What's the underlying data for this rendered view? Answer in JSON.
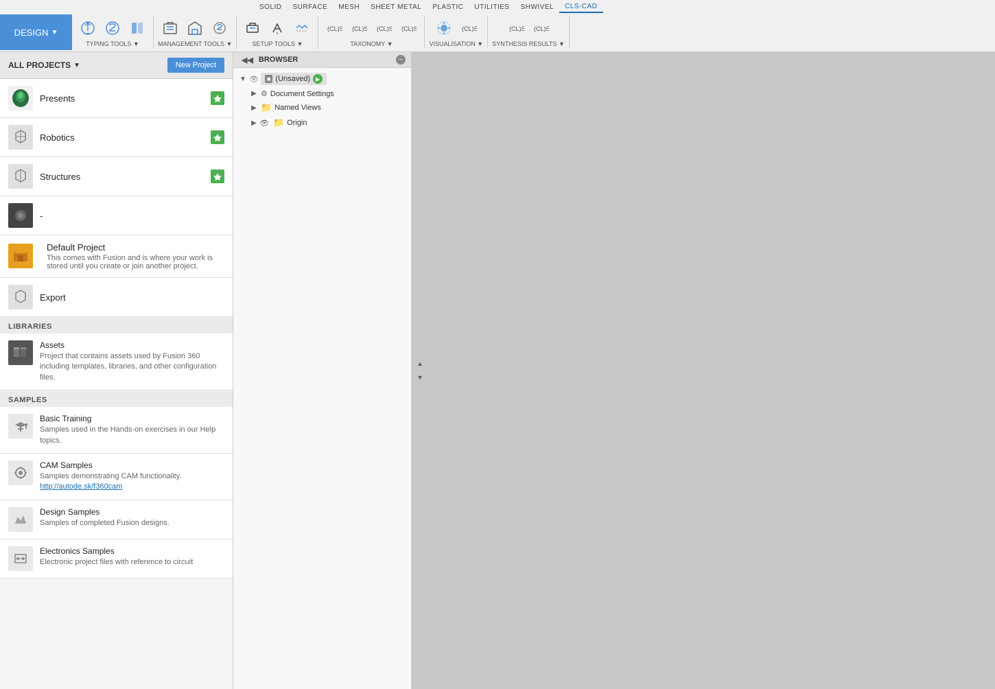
{
  "toolbar": {
    "design_label": "DESIGN",
    "design_chevron": "▼",
    "sections": [
      {
        "id": "solid",
        "label": "SOLID"
      },
      {
        "id": "surface",
        "label": "SURFACE"
      },
      {
        "id": "mesh",
        "label": "MESH"
      },
      {
        "id": "sheet_metal",
        "label": "SHEET METAL"
      },
      {
        "id": "plastic",
        "label": "PLASTIC"
      },
      {
        "id": "utilities",
        "label": "UTILITIES"
      },
      {
        "id": "shwivel",
        "label": "SHWIVEL"
      },
      {
        "id": "cls_cad",
        "label": "CLS-CAD",
        "active": true
      }
    ],
    "groups": [
      {
        "id": "typing_tools",
        "label": "TYPING TOOLS ▼"
      },
      {
        "id": "management_tools",
        "label": "MANAGEMENT TOOLS ▼"
      },
      {
        "id": "setup_tools",
        "label": "SETUP TOOLS ▼"
      },
      {
        "id": "taxonomy",
        "label": "TAXONOMY ▼"
      },
      {
        "id": "visualisation",
        "label": "VISUALISATION ▼"
      },
      {
        "id": "synthesis_results",
        "label": "SYNTHESIS RESULTS ▼"
      }
    ]
  },
  "sidebar": {
    "all_projects_label": "ALL PROJECTS",
    "new_project_label": "New Project",
    "projects": [
      {
        "id": "presents",
        "name": "Presents",
        "has_pin": true,
        "thumb_type": "logo"
      },
      {
        "id": "robotics",
        "name": "Robotics",
        "has_pin": true,
        "thumb_type": "icon"
      },
      {
        "id": "structures",
        "name": "Structures",
        "has_pin": true,
        "thumb_type": "icon"
      },
      {
        "id": "unnamed",
        "name": "-",
        "has_pin": false,
        "thumb_type": "dark"
      },
      {
        "id": "default",
        "name": "Default Project",
        "description": "This comes with Fusion and is where your work is stored until you create or join another project.",
        "has_pin": false,
        "thumb_type": "colorful"
      },
      {
        "id": "export",
        "name": "Export",
        "has_pin": false,
        "thumb_type": "icon"
      }
    ],
    "libraries_label": "LIBRARIES",
    "libraries": [
      {
        "id": "assets",
        "name": "Assets",
        "description": "Project that contains assets used by Fusion 360 including templates, libraries, and other configuration files.",
        "thumb_type": "dark"
      }
    ],
    "samples_label": "SAMPLES",
    "samples": [
      {
        "id": "basic_training",
        "name": "Basic Training",
        "description": "Samples used in the Hands-on exercises in our Help topics.",
        "thumb_type": "hat"
      },
      {
        "id": "cam_samples",
        "name": "CAM Samples",
        "description": "Samples demonstrating CAM functionality.",
        "link": "http://autode.sk/f360cam",
        "thumb_type": "gear"
      },
      {
        "id": "design_samples",
        "name": "Design Samples",
        "description": "Samples of completed Fusion designs.",
        "thumb_type": "design"
      },
      {
        "id": "electronics_samples",
        "name": "Electronics Samples",
        "description": "Electronic project files with reference to circuit",
        "thumb_type": "electronics"
      }
    ]
  },
  "browser": {
    "title": "BROWSER",
    "doc_name": "(Unsaved)",
    "tree_items": [
      {
        "id": "document_settings",
        "label": "Document Settings",
        "arrow": "▶",
        "has_gear": true
      },
      {
        "id": "named_views",
        "label": "Named Views",
        "arrow": "▶",
        "has_folder": true
      },
      {
        "id": "origin",
        "label": "Origin",
        "arrow": "▶",
        "has_eye": true,
        "has_folder": true
      }
    ]
  }
}
